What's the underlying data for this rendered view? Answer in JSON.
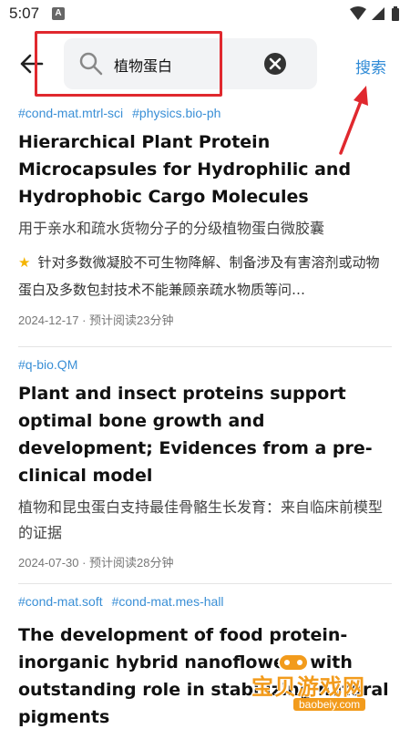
{
  "status": {
    "time": "5:07",
    "notif_glyph": "A"
  },
  "search": {
    "query": "植物蛋白",
    "button_label": "搜索"
  },
  "icons": {
    "back": "back-arrow-icon",
    "search": "search-icon",
    "clear": "clear-icon",
    "wifi": "wifi-icon",
    "signal": "signal-icon",
    "battery": "battery-icon"
  },
  "colors": {
    "accent": "#2e8ad6",
    "highlight": "#e0282e",
    "star": "#f4b400"
  },
  "articles": [
    {
      "tags": [
        "#cond-mat.mtrl-sci",
        "#physics.bio-ph"
      ],
      "title": "Hierarchical Plant Protein Microcapsules for Hydrophilic and Hydrophobic Cargo Molecules",
      "subtitle": "用于亲水和疏水货物分子的分级植物蛋白微胶囊",
      "abstract": "针对多数微凝胶不可生物降解、制备涉及有害溶剂或动物蛋白及多数包封技术不能兼顾亲疏水物质等问…",
      "meta": "2024-12-17 · 预计阅读23分钟"
    },
    {
      "tags": [
        "#q-bio.QM"
      ],
      "title": "Plant and insect proteins support optimal bone growth and development; Evidences from a pre-clinical model",
      "subtitle": "植物和昆虫蛋白支持最佳骨骼生长发育：来自临床前模型的证据",
      "meta": "2024-07-30 · 预计阅读28分钟"
    },
    {
      "tags": [
        "#cond-mat.soft",
        "#cond-mat.mes-hall"
      ],
      "title": "The development of food protein-inorganic hybrid nanoflowers with  outstanding role in stabilizing natural pigments"
    }
  ],
  "watermark": {
    "text": "宝贝游戏网",
    "url": "baobeiy.com"
  }
}
